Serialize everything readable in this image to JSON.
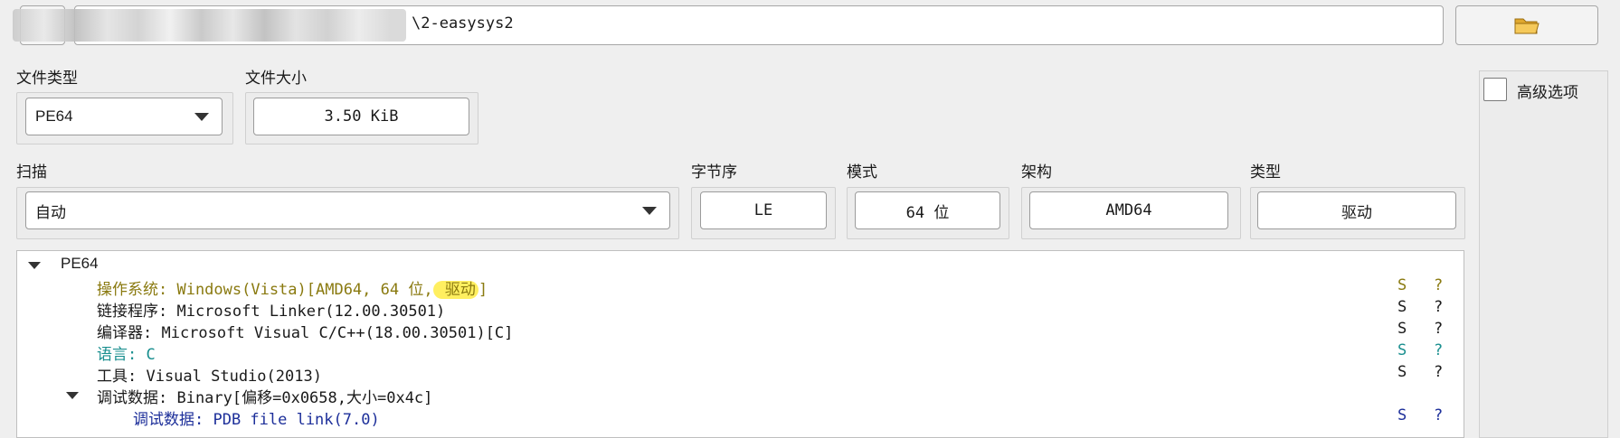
{
  "path": {
    "visible_suffix": "\\2-easysys2",
    "folder_icon": "folder-icon"
  },
  "file_type": {
    "label": "文件类型",
    "value": "PE64"
  },
  "file_size": {
    "label": "文件大小",
    "value": "3.50 KiB"
  },
  "scan": {
    "label": "扫描",
    "value": "自动"
  },
  "endianness": {
    "label": "字节序",
    "value": "LE"
  },
  "mode": {
    "label": "模式",
    "value": "64 位"
  },
  "arch": {
    "label": "架构",
    "value": "AMD64"
  },
  "type": {
    "label": "类型",
    "value": "驱动"
  },
  "advanced": {
    "label": "高级选项",
    "checked": false
  },
  "tree": {
    "root": "PE64",
    "os": {
      "text_prefix": "操作系统: Windows(Vista)[AMD64, 64 位,",
      "text_highlight": " 驱动",
      "text_suffix": "]",
      "color": "#8a7a10"
    },
    "rows": [
      {
        "text": "链接程序: Microsoft Linker(12.00.30501)",
        "color": "#1a1a1a"
      },
      {
        "text": "编译器: Microsoft Visual C/C++(18.00.30501)[C]",
        "color": "#1a1a1a"
      },
      {
        "text": "语言: C",
        "color": "#1a8f8f"
      },
      {
        "text": "工具: Visual Studio(2013)",
        "color": "#1a1a1a"
      },
      {
        "text": "调试数据: Binary[偏移=0x0658,大小=0x4c]",
        "color": "#1a1a1a"
      },
      {
        "text": "调试数据: PDB file link(7.0)",
        "color": "#1d2f9a"
      }
    ],
    "s_label": "S",
    "q_label": "?"
  },
  "colors": {
    "highlight": "#ffef60",
    "os_text": "#8a7a10",
    "lang_text": "#1a8f8f",
    "debug_text": "#1d2f9a"
  }
}
